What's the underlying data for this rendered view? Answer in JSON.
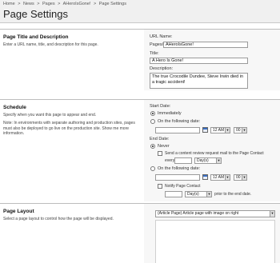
{
  "header": {
    "breadcrumb": [
      "Home",
      ">",
      "News",
      ">",
      "Pages",
      ">",
      "AHeroIsGone!",
      ">",
      "Page Settings"
    ],
    "title": "Page Settings"
  },
  "title_section": {
    "heading": "Page Title and Description",
    "description": "Enter a URL name, title, and description for this page.",
    "url_label": "URL Name:",
    "url_prefix": "Pages/",
    "url_value": "AHeroIsGone!",
    "title_label": "Title:",
    "title_value": "A Hero Is Gone!",
    "desc_label": "Description:",
    "desc_value": "The true Crocodile Dundee, Steve Irwin died in a tragic accident!"
  },
  "schedule_section": {
    "heading": "Schedule",
    "description": "Specify when you want this page to appear and end.",
    "note": "Note: In environments with separate authoring and production sites, pages must also be deployed to go live on the production site. Show me more information.",
    "start_label": "Start Date:",
    "start_immediately": "Immediately",
    "start_following": "On the following date:",
    "start_hour": "12 AM",
    "start_min": "00",
    "end_label": "End Date:",
    "end_never": "Never",
    "review_label": "Send a content review request mail to the Page Contact",
    "every_label": "every",
    "every_unit": "Day(s)",
    "end_following": "On the following date:",
    "end_hour": "12 AM",
    "end_min": "00",
    "notify_label": "Notify Page Contact",
    "notify_unit": "Day(s)",
    "notify_suffix": "prior to the end date."
  },
  "layout_section": {
    "heading": "Page Layout",
    "description": "Select a page layout to control how the page will be displayed.",
    "selected": "(Article Page) Article page with image on right"
  },
  "icons": {
    "calendar": "calendar-icon",
    "dropdown": "chevron-down-icon"
  }
}
